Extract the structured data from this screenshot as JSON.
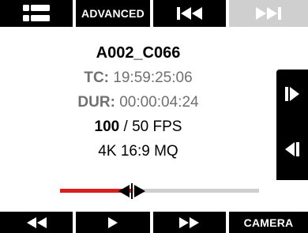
{
  "top_bar": {
    "menu_icon": "list-icon",
    "advanced_label": "ADVANCED",
    "prev_clip_icon": "skip-to-start-icon",
    "next_clip_icon": "skip-to-end-icon"
  },
  "clip": {
    "name": "A002_C066",
    "tc_label": "TC:",
    "tc_value": "19:59:25:06",
    "dur_label": "DUR:",
    "dur_value": "00:00:04:24",
    "fps_speed": "100",
    "fps_rate": "50 FPS",
    "format": "4K 16:9 MQ"
  },
  "side": {
    "frame_forward_icon": "frame-forward-icon",
    "frame_back_icon": "frame-back-icon"
  },
  "scrubber": {
    "position": 0.36,
    "played_color": "#d81f1f",
    "remaining_color": "#cfcfcf"
  },
  "bottom_bar": {
    "rewind_icon": "rewind-icon",
    "play_icon": "play-icon",
    "fast_forward_icon": "fast-forward-icon",
    "camera_label": "CAMERA"
  }
}
